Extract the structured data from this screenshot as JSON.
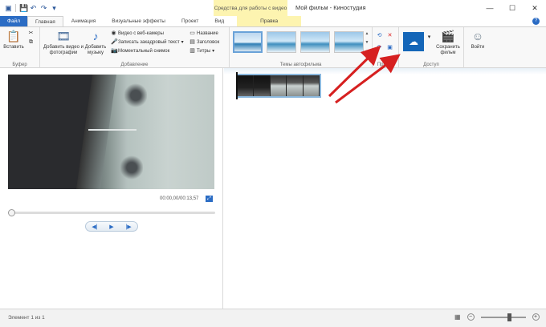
{
  "window": {
    "title": "Мой фильм - Киностудия",
    "context_group": "Средства для работы с видео",
    "controls": {
      "minimize": "—",
      "maximize": "☐",
      "close": "✕"
    }
  },
  "tabs": {
    "file": "Файл",
    "home": "Главная",
    "animation": "Анимация",
    "visual_effects": "Визуальные эффекты",
    "project": "Проект",
    "view": "Вид",
    "edit": "Правка"
  },
  "ribbon": {
    "clipboard": {
      "paste": "Вставить",
      "label": "Буфер"
    },
    "add": {
      "add_video_photos": "Добавить видео и фотографии",
      "add_music": "Добавить музыку",
      "webcam_video": "Видео с веб-камеры",
      "record_narration": "Записать закадровый текст",
      "snapshot": "Моментальный снимок",
      "title": "Название",
      "caption": "Заголовок",
      "credits": "Титры",
      "label": "Добавление"
    },
    "themes": {
      "label": "Темы автофильма"
    },
    "edit": {
      "label": "Правка"
    },
    "share": {
      "save_movie": "Сохранить фильм",
      "label": "Доступ"
    },
    "sign_in": "Войти"
  },
  "preview": {
    "timecode": "00:00,00/00:13,57"
  },
  "status": {
    "text": "Элемент 1 из 1"
  },
  "icons": {
    "accent": "#2b6cc4",
    "arrow_color": "#d62020"
  }
}
